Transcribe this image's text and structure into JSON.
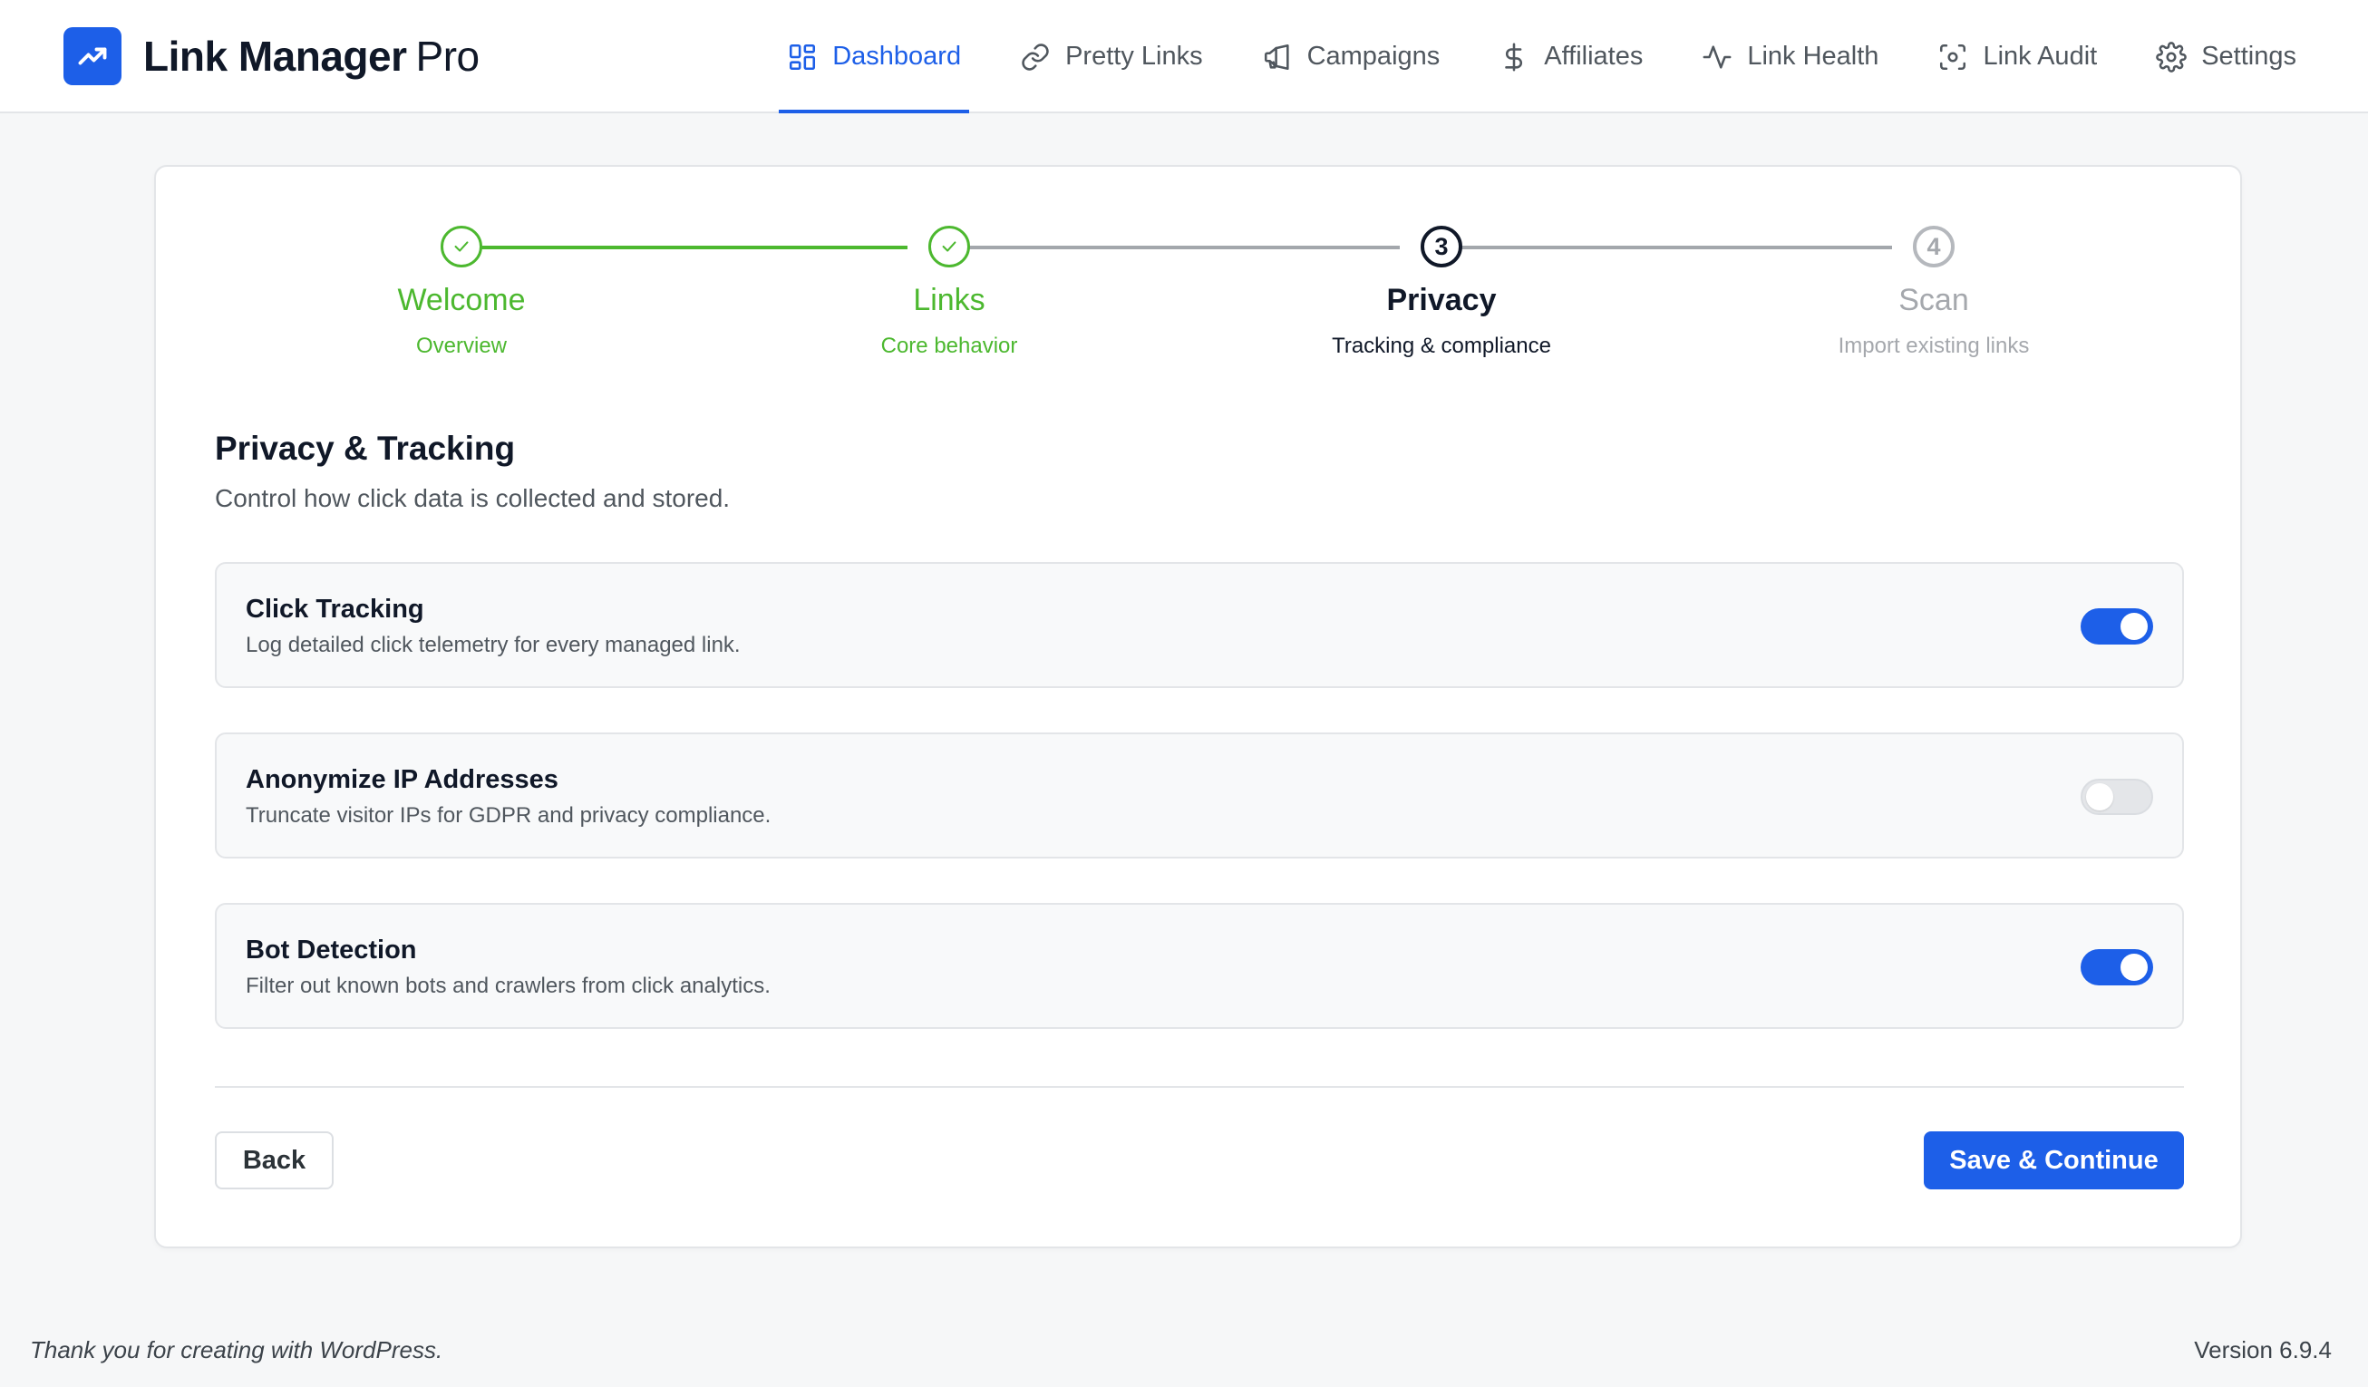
{
  "app": {
    "brand_bold": "Link Manager",
    "brand_light": "Pro"
  },
  "nav": [
    {
      "label": "Dashboard",
      "icon": "dashboard-grid-icon",
      "active": true
    },
    {
      "label": "Pretty Links",
      "icon": "link-icon",
      "active": false
    },
    {
      "label": "Campaigns",
      "icon": "megaphone-icon",
      "active": false
    },
    {
      "label": "Affiliates",
      "icon": "dollar-icon",
      "active": false
    },
    {
      "label": "Link Health",
      "icon": "pulse-icon",
      "active": false
    },
    {
      "label": "Link Audit",
      "icon": "scan-icon",
      "active": false
    },
    {
      "label": "Settings",
      "icon": "gear-icon",
      "active": false
    }
  ],
  "steps": [
    {
      "number": "1",
      "title": "Welcome",
      "subtitle": "Overview",
      "state": "complete"
    },
    {
      "number": "2",
      "title": "Links",
      "subtitle": "Core behavior",
      "state": "complete"
    },
    {
      "number": "3",
      "title": "Privacy",
      "subtitle": "Tracking & compliance",
      "state": "current"
    },
    {
      "number": "4",
      "title": "Scan",
      "subtitle": "Import existing links",
      "state": "upcoming"
    }
  ],
  "section": {
    "title": "Privacy & Tracking",
    "description": "Control how click data is collected and stored."
  },
  "settings": [
    {
      "title": "Click Tracking",
      "description": "Log detailed click telemetry for every managed link.",
      "enabled": true
    },
    {
      "title": "Anonymize IP Addresses",
      "description": "Truncate visitor IPs for GDPR and privacy compliance.",
      "enabled": false
    },
    {
      "title": "Bot Detection",
      "description": "Filter out known bots and crawlers from click analytics.",
      "enabled": true
    }
  ],
  "actions": {
    "back_label": "Back",
    "save_label": "Save & Continue"
  },
  "footer": {
    "thanks": "Thank you for creating with WordPress.",
    "version": "Version 6.9.4"
  },
  "colors": {
    "accent": "#1d5fe8",
    "complete": "#4cb82f",
    "upcoming": "#a5a8ad"
  }
}
